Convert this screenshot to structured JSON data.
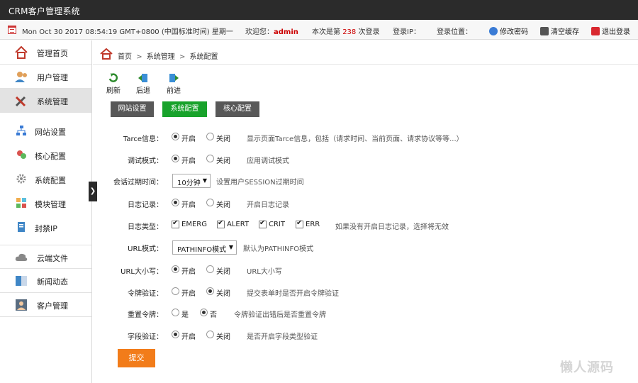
{
  "app": {
    "title": "CRM客户管理系统"
  },
  "infobar": {
    "datetime": "Mon Oct 30 2017 08:54:19 GMT+0800 (中国标准时间) 星期一",
    "welcome_prefix": "欢迎您：",
    "username": "admin",
    "visits_prefix": "本次是第",
    "visits_count": "238",
    "visits_suffix": "次登录",
    "login_ip": "登录IP：",
    "location": "登录位置：",
    "change_password": "修改密码",
    "clear_cache": "清空缓存",
    "logout": "退出登录"
  },
  "sidebar": {
    "items": [
      {
        "label": "管理首页",
        "icon": "home-icon"
      },
      {
        "label": "用户管理",
        "icon": "users-icon"
      },
      {
        "label": "系统管理",
        "icon": "tools-icon"
      }
    ],
    "sub_items": [
      {
        "label": "网站设置",
        "icon": "sitemap-icon"
      },
      {
        "label": "核心配置",
        "icon": "core-icon"
      },
      {
        "label": "系统配置",
        "icon": "gear-icon"
      },
      {
        "label": "模块管理",
        "icon": "modules-icon"
      },
      {
        "label": "封禁IP",
        "icon": "ban-icon"
      }
    ],
    "bottom_items": [
      {
        "label": "云端文件",
        "icon": "cloud-icon"
      },
      {
        "label": "新闻动态",
        "icon": "news-icon"
      },
      {
        "label": "客户管理",
        "icon": "customers-icon"
      }
    ],
    "collapse_glyph": "❯"
  },
  "breadcrumb": {
    "home": "首页",
    "sep": ">",
    "section": "系统管理",
    "page": "系统配置"
  },
  "toolbar": {
    "refresh": "刷新",
    "back": "后退",
    "forward": "前进"
  },
  "tabs": {
    "site": "网站设置",
    "system": "系统配置",
    "core": "核心配置"
  },
  "form": {
    "tarce": {
      "label": "Tarce信息：",
      "on": "开启",
      "off": "关闭",
      "hint": "显示页面Tarce信息，包括（请求时间、当前页面、请求协议等等...）"
    },
    "debug": {
      "label": "调试模式：",
      "on": "开启",
      "off": "关闭",
      "hint": "应用调试模式"
    },
    "session": {
      "label": "会话过期时间：",
      "value": "10分钟",
      "hint": "设置用户SESSION过期时间"
    },
    "log": {
      "label": "日志记录：",
      "on": "开启",
      "off": "关闭",
      "hint": "开启日志记录"
    },
    "logtype": {
      "label": "日志类型：",
      "opt1": "EMERG",
      "opt2": "ALERT",
      "opt3": "CRIT",
      "opt4": "ERR",
      "hint": "如果没有开启日志记录，选择将无效"
    },
    "url_mode": {
      "label": "URL模式：",
      "value": "PATHINFO模式",
      "hint": "默认为PATHINFO模式"
    },
    "url_case": {
      "label": "URL大小写：",
      "on": "开启",
      "off": "关闭",
      "hint": "URL大小写"
    },
    "token": {
      "label": "令牌验证：",
      "on": "开启",
      "off": "关闭",
      "hint": "提交表单时是否开启令牌验证"
    },
    "token_reset": {
      "label": "重置令牌：",
      "yes": "是",
      "no": "否",
      "hint": "令牌验证出错后是否重置令牌"
    },
    "field_check": {
      "label": "字段验证：",
      "on": "开启",
      "off": "关闭",
      "hint": "是否开启字段类型验证"
    },
    "submit": "提交"
  },
  "watermark": "懒人源码"
}
